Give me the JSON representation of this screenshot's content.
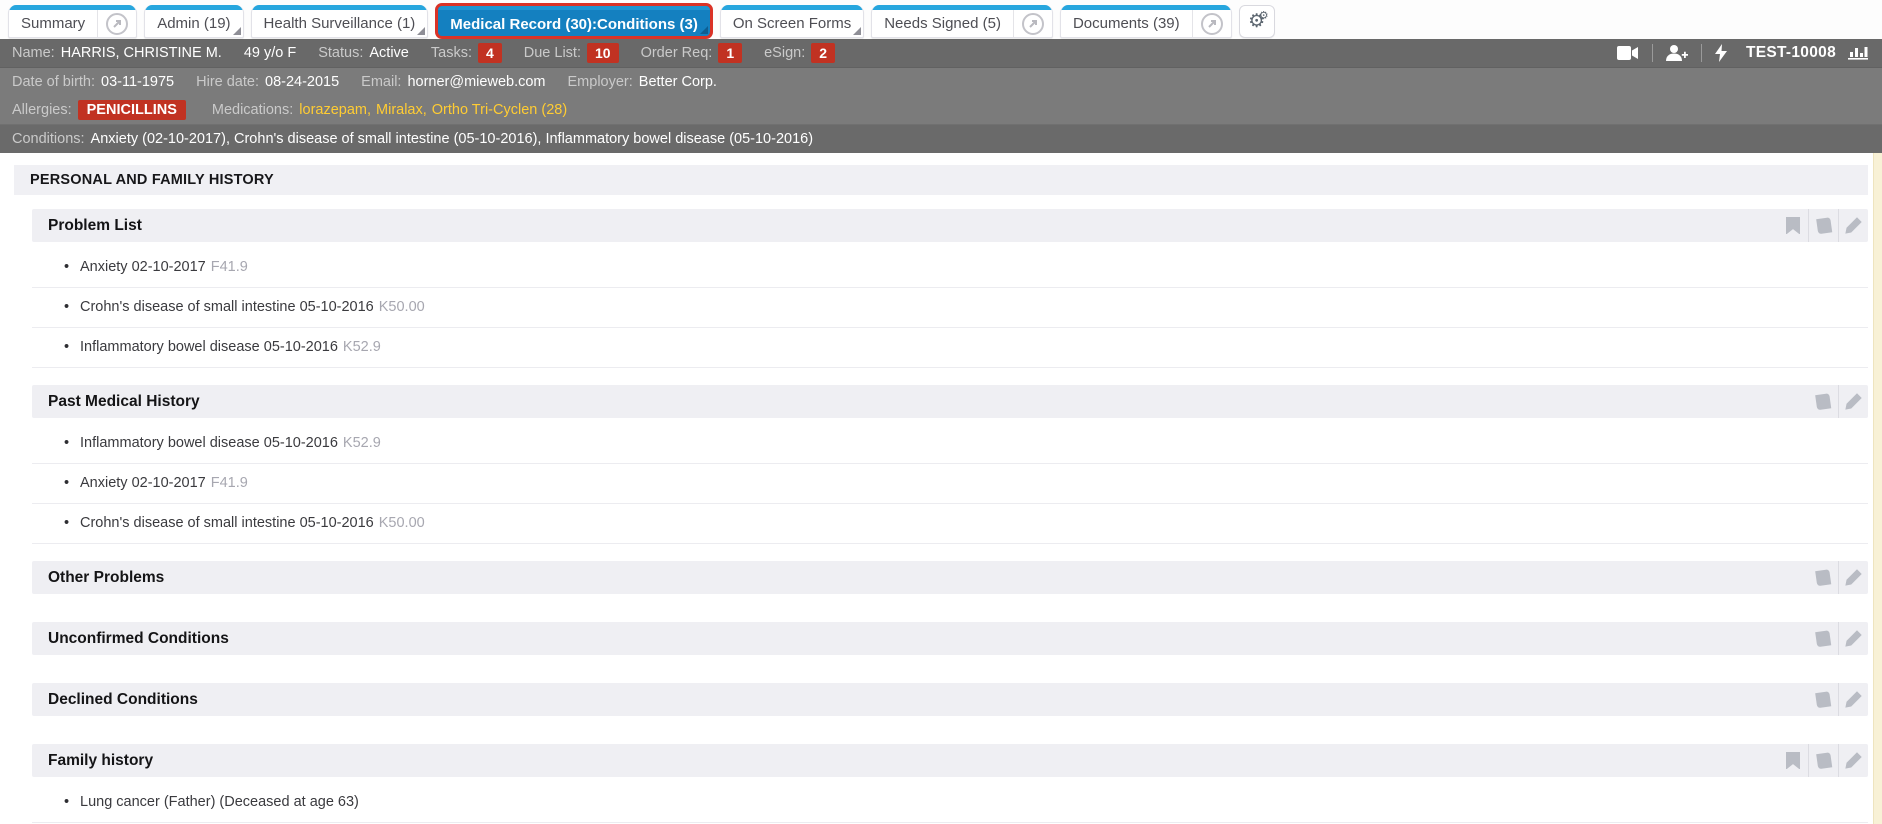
{
  "colors": {
    "tab_accent_blue": "#27a6de",
    "active_tab_blue": "#1480c0",
    "active_tab_focus_red": "#da3327",
    "badge_red": "#c13222",
    "medication_yellow": "#ffcc33",
    "header_gray": "#7b7b7b",
    "section_band_gray": "#efeff3"
  },
  "tab_bar": {
    "tabs": [
      {
        "label": "Summary"
      },
      {
        "label": "Admin (19)"
      },
      {
        "label": "Health Surveillance (1)"
      },
      {
        "label": "Medical Record (30):Conditions (3)"
      },
      {
        "label": "On Screen Forms"
      },
      {
        "label": "Needs Signed (5)"
      },
      {
        "label": "Documents (39)"
      }
    ],
    "active_tab": "Medical Record (30):Conditions (3)"
  },
  "patient": {
    "name_label": "Name:",
    "name": "HARRIS, CHRISTINE M.",
    "age_sex": "49 y/o F",
    "status_label": "Status:",
    "status": "Active",
    "tasks_label": "Tasks:",
    "tasks_count": "4",
    "due_list_label": "Due List:",
    "due_list_count": "10",
    "order_req_label": "Order Req:",
    "order_req_count": "1",
    "esign_label": "eSign:",
    "esign_count": "2",
    "chart_id": "TEST-10008",
    "dob_label": "Date of birth:",
    "dob": "03-11-1975",
    "hire_label": "Hire date:",
    "hire": "08-24-2015",
    "email_label": "Email:",
    "email": "horner@mieweb.com",
    "employer_label": "Employer:",
    "employer": "Better Corp.",
    "allergies_label": "Allergies:",
    "allergy": "PENICILLINS",
    "medications_label": "Medications:",
    "medications": [
      {
        "name": "lorazepam,"
      },
      {
        "name": "Miralax,"
      },
      {
        "name": "Ortho Tri-Cyclen (28)"
      }
    ],
    "conditions_label": "Conditions:",
    "conditions": "Anxiety (02-10-2017), Crohn's disease of small intestine (05-10-2016), Inflammatory bowel disease (05-10-2016)"
  },
  "main": {
    "page_title": "PERSONAL AND FAMILY HISTORY",
    "sections": [
      {
        "title": "Problem List",
        "icons": [
          "bookmark",
          "book",
          "pencil"
        ],
        "items": [
          {
            "text": "Anxiety 02-10-2017",
            "code": "F41.9"
          },
          {
            "text": "Crohn's disease of small intestine 05-10-2016",
            "code": "K50.00"
          },
          {
            "text": "Inflammatory bowel disease 05-10-2016",
            "code": "K52.9"
          }
        ]
      },
      {
        "title": "Past Medical History",
        "icons": [
          "book",
          "pencil"
        ],
        "items": [
          {
            "text": "Inflammatory bowel disease 05-10-2016",
            "code": "K52.9"
          },
          {
            "text": "Anxiety 02-10-2017",
            "code": "F41.9"
          },
          {
            "text": "Crohn's disease of small intestine 05-10-2016",
            "code": "K50.00"
          }
        ]
      },
      {
        "title": "Other Problems",
        "icons": [
          "book",
          "pencil"
        ],
        "items": []
      },
      {
        "title": "Unconfirmed Conditions",
        "icons": [
          "book",
          "pencil"
        ],
        "items": []
      },
      {
        "title": "Declined Conditions",
        "icons": [
          "book",
          "pencil"
        ],
        "items": []
      },
      {
        "title": "Family history",
        "icons": [
          "bookmark",
          "book",
          "pencil"
        ],
        "items": [
          {
            "text": "Lung cancer (Father) (Deceased at age 63)",
            "code": ""
          }
        ]
      }
    ]
  }
}
